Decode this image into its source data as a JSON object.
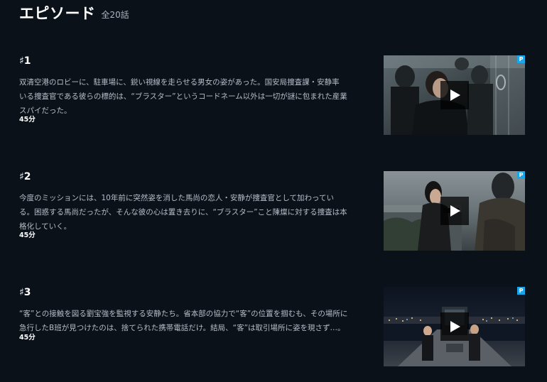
{
  "header": {
    "title": "エピソード",
    "count": "全20話"
  },
  "episodes": [
    {
      "number": "♯1",
      "description_lines": [
        "双清空港のロビーに、駐車場に、鋭い視線を走らせる男女の姿があった。国安局捜査課・安静率",
        "いる捜査官である彼らの標的は、“ブラスター”というコードネーム以外は一切が謎に包まれた産業",
        "スパイだった。"
      ],
      "duration": "45分",
      "badge": "P"
    },
    {
      "number": "♯2",
      "description_lines": [
        "今度のミッションには、10年前に突然姿を消した馬尚の恋人・安静が捜査官として加わってい",
        "る。困惑する馬尚だったが、そんな彼の心は置き去りに、“ブラスター”こと陳燦に対する捜査は本",
        "格化していく。"
      ],
      "duration": "45分",
      "badge": "P"
    },
    {
      "number": "♯3",
      "description_lines": [
        "“客”との接触を図る劉宝強を監視する安静たち。省本部の協力で“客”の位置を掴むも、その場所に",
        "急行したB班が見つけたのは、捨てられた携帯電話だけ。結局、“客”は取引場所に姿を現さず…。"
      ],
      "duration": "45分",
      "badge": "P"
    }
  ],
  "icons": {
    "play": "play-icon",
    "premium_badge": "premium-badge"
  },
  "colors": {
    "background": "#0a1119",
    "badge": "#1aa6e8"
  }
}
